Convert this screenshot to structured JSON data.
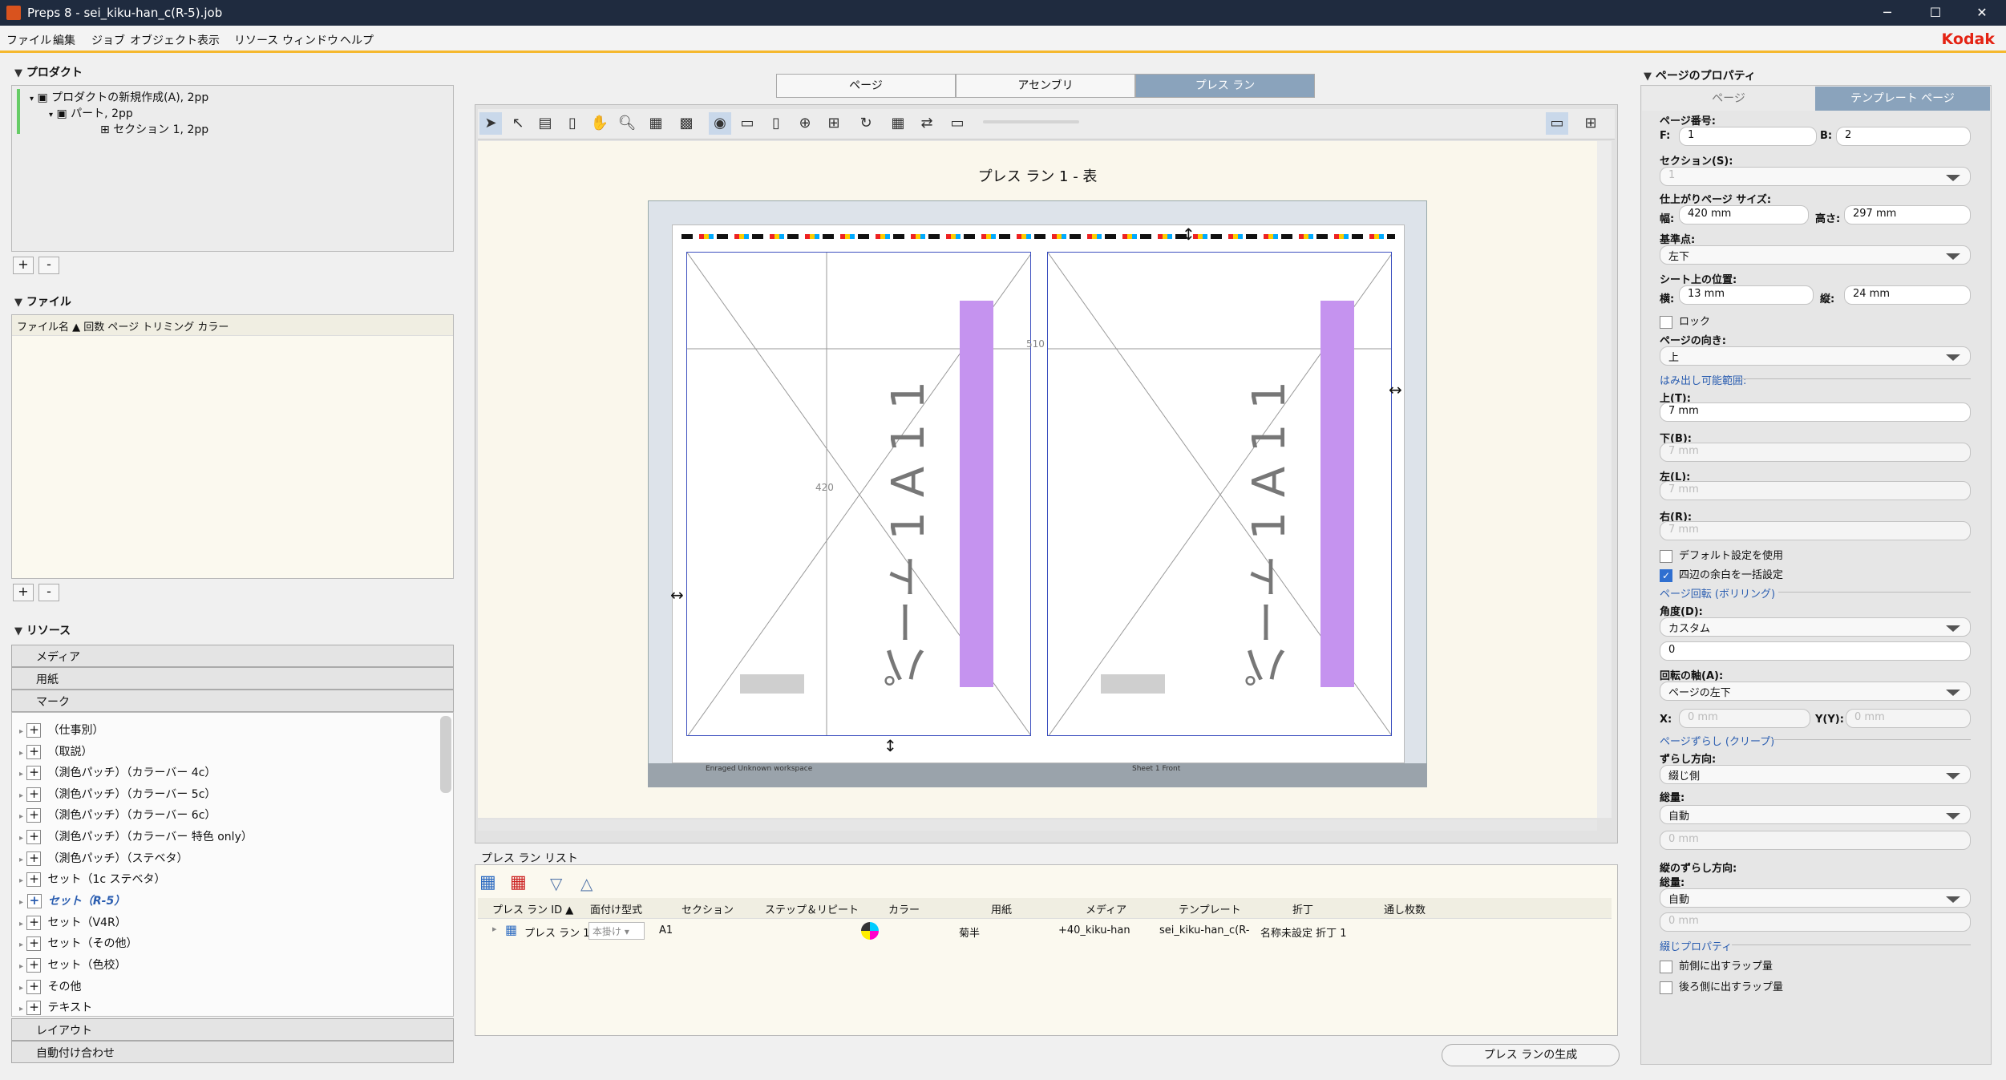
{
  "window": {
    "title": "Preps 8 - sei_kiku-han_c(R-5).job",
    "minimize": "─",
    "maximize": "☐",
    "close": "✕"
  },
  "menu": [
    "ファイル",
    "編集",
    "ジョブ",
    "オブジェクト",
    "表示",
    "リソース",
    "ウィンドウ",
    "ヘルプ"
  ],
  "brand": "Kodak",
  "product": {
    "title": "プロダクト",
    "tree": [
      "プロダクトの新規作成(A), 2pp",
      "パート, 2pp",
      "セクション 1, 2pp"
    ],
    "add": "+",
    "remove": "-"
  },
  "files": {
    "title": "ファイル",
    "columns": "ファイル名 ▲ 回数 ページ トリミング カラー",
    "add": "+",
    "remove": "-"
  },
  "resources": {
    "title": "リソース",
    "media": "メディア",
    "paper": "用紙",
    "marks": "マーク",
    "items": [
      "（仕事別）",
      "（取説）",
      "（測色パッチ）（カラーバー 4c）",
      "（測色パッチ）（カラーバー 5c）",
      "（測色パッチ）（カラーバー 6c）",
      "（測色パッチ）（カラーバー 特色 only）",
      "（測色パッチ）（ステベタ）",
      "セット（1c ステベタ）",
      "セット（R-5）",
      "セット（V4R）",
      "セット（その他）",
      "セット（色校）",
      "その他",
      "テキスト"
    ],
    "layout": "レイアウト",
    "auto": "自動付け合わせ"
  },
  "tabs": [
    "ページ",
    "アセンブリ",
    "プレス ラン"
  ],
  "canvas": {
    "title": "プレス ラン 1 - 表",
    "page_label": "パート 1 A 1 1",
    "dim_w": "510",
    "dim_h": "420",
    "foot_left": "Enraged Unknown workspace",
    "foot_right": "Sheet 1 Front"
  },
  "pressrun": {
    "title": "プレス ラン リスト",
    "columns": [
      "プレス ラン ID ▲",
      "面付け型式",
      "セクション",
      "ステップ＆リピート",
      "カラー",
      "用紙",
      "メディア",
      "テンプレート",
      "折丁",
      "通し枚数"
    ],
    "row": {
      "id": "プレス ラン 1",
      "type": "本掛け",
      "section": "A1",
      "paper": "菊半",
      "media": "+40_kiku-han",
      "template": "sei_kiku-han_c(R-",
      "fold": "名称未設定 折丁 1"
    },
    "generate": "プレス ランの生成"
  },
  "props": {
    "title": "ページのプロパティ",
    "tab_page": "ページ",
    "tab_template": "テンプレート ページ",
    "page_no": "ページ番号:",
    "f_label": "F:",
    "f_val": "1",
    "b_label": "B:",
    "b_val": "2",
    "section": "セクション(S):",
    "section_val": "1",
    "trim": "仕上がりページ サイズ:",
    "w_label": "幅:",
    "w_val": "420 mm",
    "h_label": "高さ:",
    "h_val": "297 mm",
    "ref": "基準点:",
    "ref_val": "左下",
    "pos": "シート上の位置:",
    "x_label": "横:",
    "x_val": "13 mm",
    "y_label": "縦:",
    "y_val": "24 mm",
    "lock": "ロック",
    "orient": "ページの向き:",
    "orient_val": "上",
    "bleed": "はみ出し可能範囲:",
    "top": "上(T):",
    "top_val": "7 mm",
    "bottom": "下(B):",
    "bottom_val": "7 mm",
    "left": "左(L):",
    "left_val": "7 mm",
    "right": "右(R):",
    "right_val": "7 mm",
    "default": "デフォルト設定を使用",
    "all": "四辺の余白を一括設定",
    "rot": "ページ回転 (ボリリング)",
    "angle": "角度(D):",
    "angle_val": "カスタム",
    "angle_num": "0",
    "axis": "回転の軸(A):",
    "axis_val": "ページの左下",
    "ax_x": "X:",
    "ax_x_val": "0 mm",
    "ax_y": "Y(Y):",
    "ax_y_val": "0 mm",
    "creep": "ページずらし (クリープ)",
    "dir": "ずらし方向:",
    "dir_val": "綴じ側",
    "total": "総量:",
    "total_val": "自動",
    "total_mm": "0 mm",
    "vdir": "縦のずらし方向:",
    "vtotal": "総量:",
    "vtotal_val": "自動",
    "vtotal_mm": "0 mm",
    "bind": "綴じプロパティ",
    "lap_front": "前側に出すラップ量",
    "lap_back": "後ろ側に出すラップ量"
  }
}
